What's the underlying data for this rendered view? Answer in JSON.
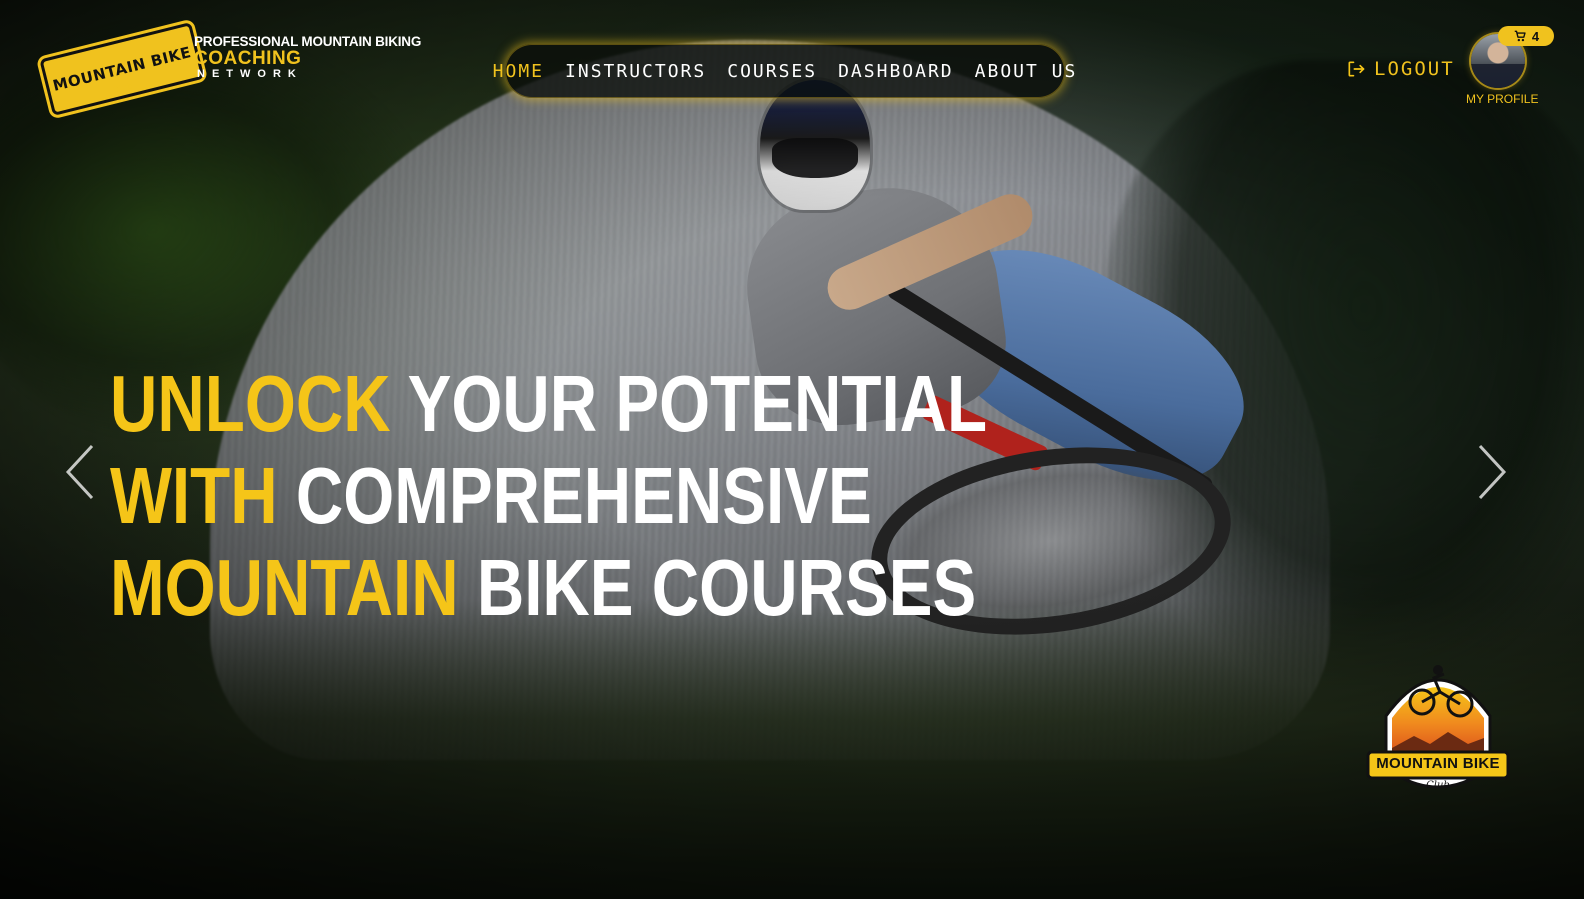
{
  "brand": {
    "badge_text": "MOUNTAIN BIKE",
    "badge_sub": "Club",
    "line1": "PROFESSIONAL MOUNTAIN BIKING",
    "line2": "COACHING",
    "line3": "NETWORK"
  },
  "nav": {
    "items": [
      {
        "label": "HOME",
        "active": true
      },
      {
        "label": "INSTRUCTORS",
        "active": false
      },
      {
        "label": "COURSES",
        "active": false
      },
      {
        "label": "DASHBOARD",
        "active": false
      },
      {
        "label": "ABOUT US",
        "active": false
      }
    ]
  },
  "account": {
    "logout_label": "LOGOUT",
    "cart_count": "4",
    "profile_label": "MY PROFILE"
  },
  "hero": {
    "line1_highlight": "UNLOCK",
    "line1_rest": "YOUR POTENTIAL",
    "line2_highlight": "WITH",
    "line2_rest": "COMPREHENSIVE",
    "line3_highlight": "MOUNTAIN",
    "line3_rest": "BIKE COURSES"
  },
  "club_badge": {
    "text": "MOUNTAIN BIKE",
    "sub": "Club"
  },
  "colors": {
    "accent": "#f5c518",
    "text": "#ffffff",
    "nav_bg": "#0a0e0a"
  },
  "icons": {
    "logout": "logout-icon",
    "cart": "cart-icon",
    "prev": "chevron-left-icon",
    "next": "chevron-right-icon"
  }
}
